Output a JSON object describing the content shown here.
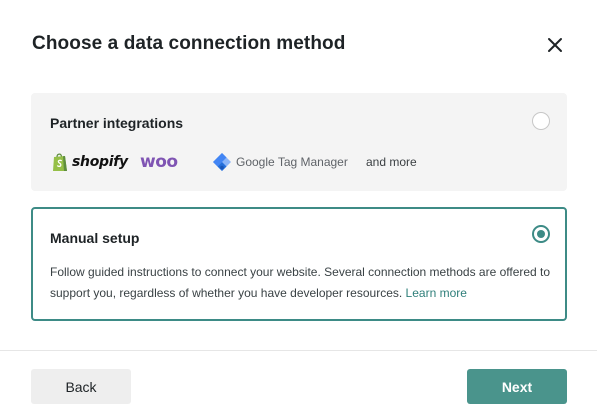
{
  "dialog": {
    "title": "Choose a data connection method",
    "close_icon": "close-icon"
  },
  "partner_card": {
    "title": "Partner integrations",
    "selected": false,
    "logos": {
      "shopify": "shopify",
      "woo": "woo",
      "gtm": "Google Tag Manager",
      "more": "and more"
    }
  },
  "manual_card": {
    "title": "Manual setup",
    "selected": true,
    "description": "Follow guided instructions to connect your website. Several connection methods are offered to support you, regardless of whether you have developer resources.",
    "learn_more": "Learn more"
  },
  "footer": {
    "back_label": "Back",
    "next_label": "Next"
  },
  "colors": {
    "accent": "#3d8b86",
    "next_button": "#4a948c",
    "woo_purple": "#7f54b3",
    "shopify_green": "#95bf47"
  }
}
